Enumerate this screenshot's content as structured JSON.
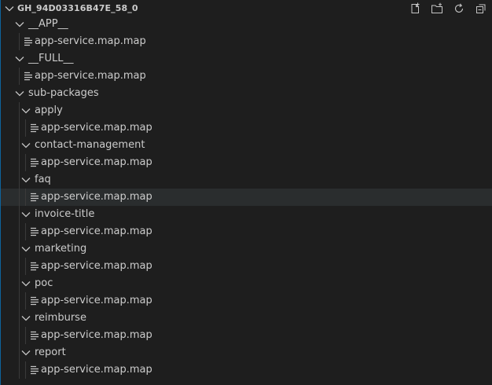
{
  "header": {
    "title": "GH_94D03316B47E_58_0",
    "actions": [
      {
        "name": "new-file-icon"
      },
      {
        "name": "new-folder-icon"
      },
      {
        "name": "refresh-icon"
      },
      {
        "name": "collapse-all-icon"
      }
    ]
  },
  "tree": {
    "app_folder": "__APP__",
    "app_file": "app-service.map.map",
    "full_folder": "__FULL__",
    "full_file": "app-service.map.map",
    "subpackages_folder": "sub-packages",
    "apply_folder": "apply",
    "apply_file": "app-service.map.map",
    "contact_folder": "contact-management",
    "contact_file": "app-service.map.map",
    "faq_folder": "faq",
    "faq_file": "app-service.map.map",
    "invoice_folder": "invoice-title",
    "invoice_file": "app-service.map.map",
    "marketing_folder": "marketing",
    "marketing_file": "app-service.map.map",
    "poc_folder": "poc",
    "poc_file": "app-service.map.map",
    "reimburse_folder": "reimburse",
    "reimburse_file": "app-service.map.map",
    "report_folder": "report",
    "report_file": "app-service.map.map"
  },
  "colors": {
    "background": "#1e1e1e",
    "text": "#cccccc",
    "hover": "#2a2d2e",
    "focus_border": "#0e639c"
  }
}
